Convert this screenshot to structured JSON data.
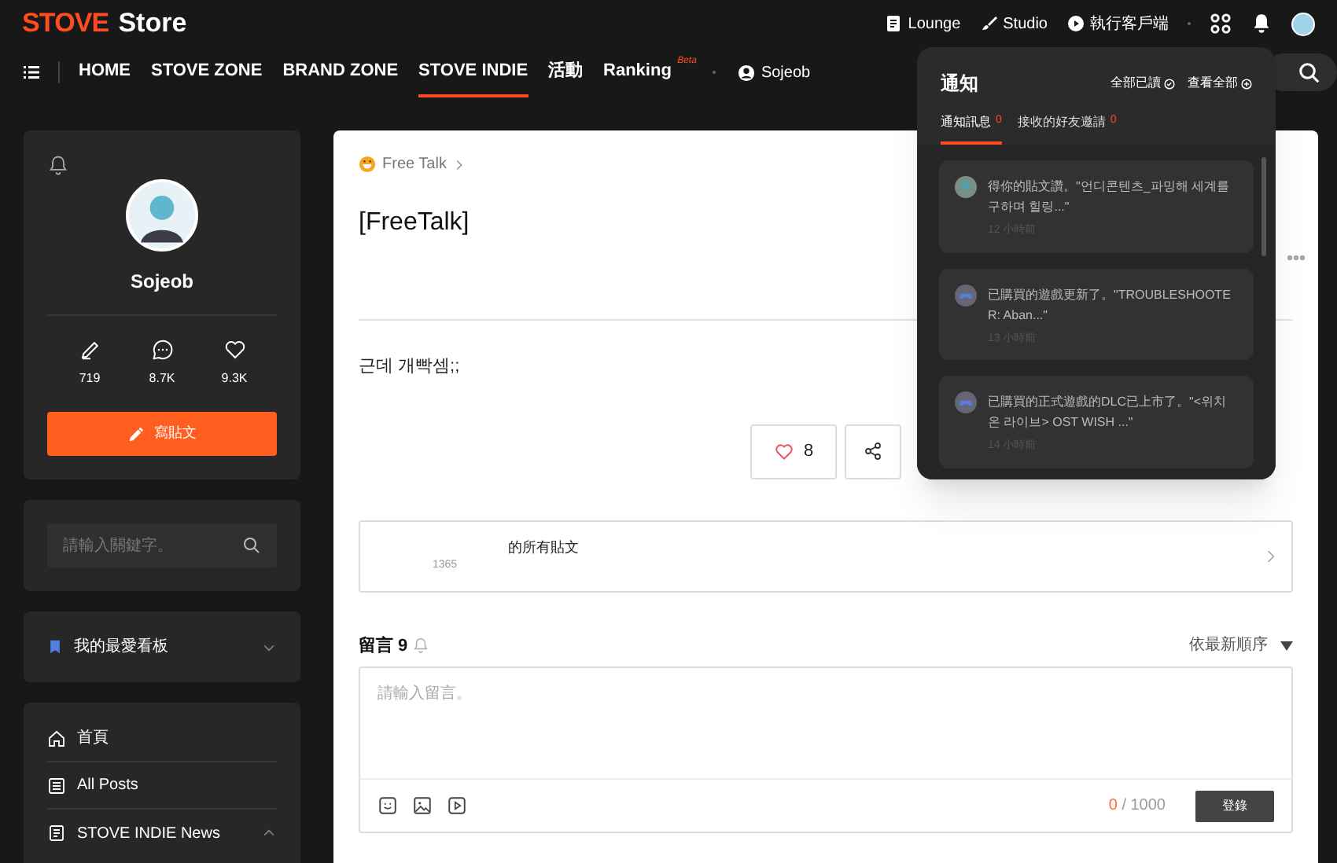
{
  "header": {
    "logo_brand": "STOVE",
    "logo_product": "Store",
    "top_links": [
      {
        "label": "Lounge",
        "kind": "doc"
      },
      {
        "label": "Studio",
        "kind": "brush"
      },
      {
        "label": "執行客戶端",
        "kind": "play"
      }
    ],
    "nav": [
      {
        "label": "HOME",
        "selected": false
      },
      {
        "label": "STOVE ZONE",
        "selected": false
      },
      {
        "label": "BRAND ZONE",
        "selected": false
      },
      {
        "label": "STOVE INDIE",
        "selected": true
      },
      {
        "label": "活動",
        "selected": false
      },
      {
        "label": "Ranking",
        "selected": false,
        "badge": "Beta"
      }
    ],
    "user": "Sojeob"
  },
  "sidebar": {
    "profile": {
      "name": "Sojeob",
      "stats": [
        {
          "kind": "posts",
          "value": "719"
        },
        {
          "kind": "comments",
          "value": "8.7K"
        },
        {
          "kind": "likes",
          "value": "9.3K"
        }
      ],
      "write_button": "寫貼文"
    },
    "search": {
      "placeholder": "請輸入關鍵字。"
    },
    "favorites": {
      "label": "我的最愛看板",
      "expanded": false
    },
    "menu": [
      {
        "label": "首頁",
        "kind": "home",
        "expanded": false
      },
      {
        "label": "All Posts",
        "kind": "list",
        "expanded": false
      },
      {
        "label": "STOVE INDIE News",
        "kind": "news",
        "expanded": true
      }
    ]
  },
  "post": {
    "breadcrumb": "Free Talk",
    "title": "[FreeTalk]",
    "body": "근데 개빡셈;;",
    "likes": "8",
    "author_posts_label": "的所有貼文",
    "author_stat": "1365"
  },
  "comments": {
    "title": "留言 9",
    "sort": "依最新順序",
    "placeholder": "請輸入留言。",
    "count": "0",
    "limit": "/ 1000",
    "submit": "登錄"
  },
  "notifications": {
    "title": "通知",
    "mark_all_read": "全部已讀",
    "view_all": "查看全部",
    "tabs": [
      {
        "label": "通知訊息",
        "count": "0",
        "selected": true
      },
      {
        "label": "接收的好友邀請",
        "count": "0",
        "selected": false
      }
    ],
    "items": [
      {
        "kind": "user",
        "text": "得你的貼文讚。\"언디콘텐츠_파밍해 세계를 구하며 힐링...\"",
        "time": "12 小時前"
      },
      {
        "kind": "game",
        "text": "已購買的遊戲更新了。\"TROUBLESHOOTER: Aban...\"",
        "time": "13 小時前"
      },
      {
        "kind": "game",
        "text": "已購買的正式遊戲的DLC已上市了。\"<위치 온 라이브> OST WISH ...\"",
        "time": "14 小時前"
      }
    ]
  }
}
